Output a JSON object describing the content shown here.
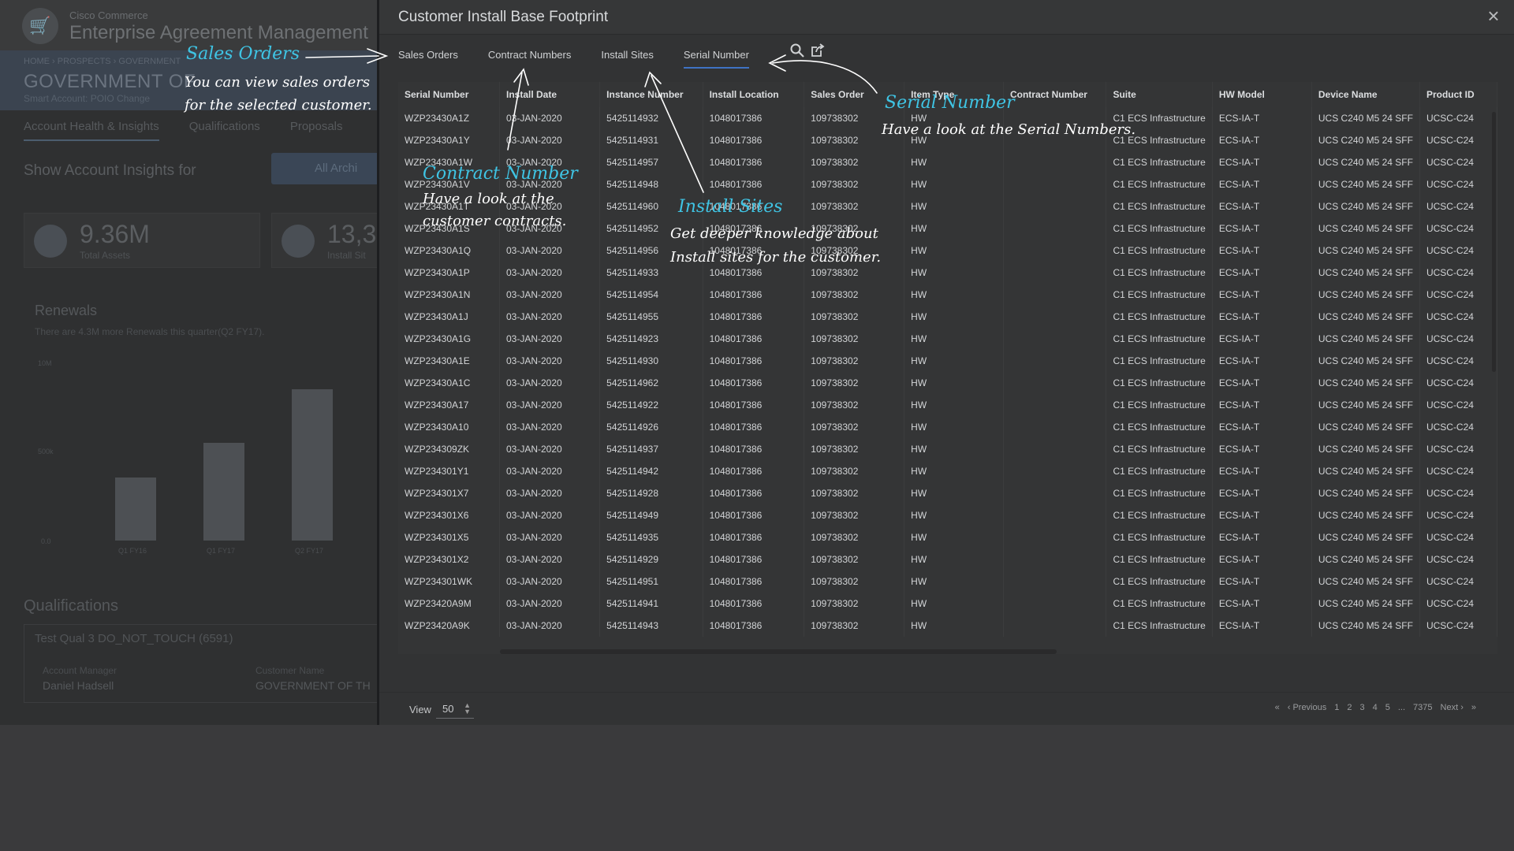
{
  "background": {
    "company": "Cisco Commerce",
    "app_name": "Enterprise Agreement Management",
    "breadcrumb": "HOME  ›  PROSPECTS  ›  GOVERNMENT",
    "customer_name": "GOVERNMENT OF",
    "smart_account": "Smart Account: POIO Change",
    "tabs": [
      "Account Health & Insights",
      "Qualifications",
      "Proposals"
    ],
    "insights_label": "Show Account Insights for",
    "archive_label": "All Archi",
    "cards": [
      {
        "value": "9.36M",
        "label": "Total Assets"
      },
      {
        "value": "13,3",
        "label": "Install Sit"
      }
    ],
    "renewals_title": "Renewals",
    "renewals_sub": "There are 4.3M more Renewals this quarter(Q2 FY17).",
    "chart_y_ticks": [
      "10M",
      "500k",
      "0.0"
    ],
    "chart_x_labels": [
      "Q1 FY16",
      "Q1 FY17",
      "Q2 FY17"
    ],
    "qualifications_title": "Qualifications",
    "qualification_name": "Test Qual 3 DO_NOT_TOUCH (6591)",
    "account_manager_label": "Account Manager",
    "account_manager": "Daniel Hadsell",
    "customer_name_label": "Customer Name",
    "customer_name_value": "GOVERNMENT OF TH"
  },
  "modal": {
    "title": "Customer Install Base Footprint",
    "close_glyph": "×",
    "tabs": [
      {
        "label": "Sales Orders",
        "active": false
      },
      {
        "label": "Contract Numbers",
        "active": false
      },
      {
        "label": "Install Sites",
        "active": false
      },
      {
        "label": "Serial Number",
        "active": true
      }
    ],
    "columns": [
      "Serial Number",
      "Install Date",
      "Instance Number",
      "Install Location",
      "Sales Order",
      "Item Type",
      "Contract Number",
      "Suite",
      "HW Model",
      "Device Name",
      "Product ID"
    ],
    "rows": [
      [
        "WZP23430A1Z",
        "03-JAN-2020",
        "5425114932",
        "1048017386",
        "109738302",
        "HW",
        "",
        "C1 ECS Infrastructure",
        "ECS-IA-T",
        "UCS C240 M5 24 SFF",
        "UCSC-C24"
      ],
      [
        "WZP23430A1Y",
        "03-JAN-2020",
        "5425114931",
        "1048017386",
        "109738302",
        "HW",
        "",
        "C1 ECS Infrastructure",
        "ECS-IA-T",
        "UCS C240 M5 24 SFF",
        "UCSC-C24"
      ],
      [
        "WZP23430A1W",
        "03-JAN-2020",
        "5425114957",
        "1048017386",
        "109738302",
        "HW",
        "",
        "C1 ECS Infrastructure",
        "ECS-IA-T",
        "UCS C240 M5 24 SFF",
        "UCSC-C24"
      ],
      [
        "WZP23430A1V",
        "03-JAN-2020",
        "5425114948",
        "1048017386",
        "109738302",
        "HW",
        "",
        "C1 ECS Infrastructure",
        "ECS-IA-T",
        "UCS C240 M5 24 SFF",
        "UCSC-C24"
      ],
      [
        "WZP23430A1T",
        "03-JAN-2020",
        "5425114960",
        "1048017386",
        "109738302",
        "HW",
        "",
        "C1 ECS Infrastructure",
        "ECS-IA-T",
        "UCS C240 M5 24 SFF",
        "UCSC-C24"
      ],
      [
        "WZP23430A1S",
        "03-JAN-2020",
        "5425114952",
        "1048017386",
        "109738302",
        "HW",
        "",
        "C1 ECS Infrastructure",
        "ECS-IA-T",
        "UCS C240 M5 24 SFF",
        "UCSC-C24"
      ],
      [
        "WZP23430A1Q",
        "03-JAN-2020",
        "5425114956",
        "1048017386",
        "109738302",
        "HW",
        "",
        "C1 ECS Infrastructure",
        "ECS-IA-T",
        "UCS C240 M5 24 SFF",
        "UCSC-C24"
      ],
      [
        "WZP23430A1P",
        "03-JAN-2020",
        "5425114933",
        "1048017386",
        "109738302",
        "HW",
        "",
        "C1 ECS Infrastructure",
        "ECS-IA-T",
        "UCS C240 M5 24 SFF",
        "UCSC-C24"
      ],
      [
        "WZP23430A1N",
        "03-JAN-2020",
        "5425114954",
        "1048017386",
        "109738302",
        "HW",
        "",
        "C1 ECS Infrastructure",
        "ECS-IA-T",
        "UCS C240 M5 24 SFF",
        "UCSC-C24"
      ],
      [
        "WZP23430A1J",
        "03-JAN-2020",
        "5425114955",
        "1048017386",
        "109738302",
        "HW",
        "",
        "C1 ECS Infrastructure",
        "ECS-IA-T",
        "UCS C240 M5 24 SFF",
        "UCSC-C24"
      ],
      [
        "WZP23430A1G",
        "03-JAN-2020",
        "5425114923",
        "1048017386",
        "109738302",
        "HW",
        "",
        "C1 ECS Infrastructure",
        "ECS-IA-T",
        "UCS C240 M5 24 SFF",
        "UCSC-C24"
      ],
      [
        "WZP23430A1E",
        "03-JAN-2020",
        "5425114930",
        "1048017386",
        "109738302",
        "HW",
        "",
        "C1 ECS Infrastructure",
        "ECS-IA-T",
        "UCS C240 M5 24 SFF",
        "UCSC-C24"
      ],
      [
        "WZP23430A1C",
        "03-JAN-2020",
        "5425114962",
        "1048017386",
        "109738302",
        "HW",
        "",
        "C1 ECS Infrastructure",
        "ECS-IA-T",
        "UCS C240 M5 24 SFF",
        "UCSC-C24"
      ],
      [
        "WZP23430A17",
        "03-JAN-2020",
        "5425114922",
        "1048017386",
        "109738302",
        "HW",
        "",
        "C1 ECS Infrastructure",
        "ECS-IA-T",
        "UCS C240 M5 24 SFF",
        "UCSC-C24"
      ],
      [
        "WZP23430A10",
        "03-JAN-2020",
        "5425114926",
        "1048017386",
        "109738302",
        "HW",
        "",
        "C1 ECS Infrastructure",
        "ECS-IA-T",
        "UCS C240 M5 24 SFF",
        "UCSC-C24"
      ],
      [
        "WZP234309ZK",
        "03-JAN-2020",
        "5425114937",
        "1048017386",
        "109738302",
        "HW",
        "",
        "C1 ECS Infrastructure",
        "ECS-IA-T",
        "UCS C240 M5 24 SFF",
        "UCSC-C24"
      ],
      [
        "WZP234301Y1",
        "03-JAN-2020",
        "5425114942",
        "1048017386",
        "109738302",
        "HW",
        "",
        "C1 ECS Infrastructure",
        "ECS-IA-T",
        "UCS C240 M5 24 SFF",
        "UCSC-C24"
      ],
      [
        "WZP234301X7",
        "03-JAN-2020",
        "5425114928",
        "1048017386",
        "109738302",
        "HW",
        "",
        "C1 ECS Infrastructure",
        "ECS-IA-T",
        "UCS C240 M5 24 SFF",
        "UCSC-C24"
      ],
      [
        "WZP234301X6",
        "03-JAN-2020",
        "5425114949",
        "1048017386",
        "109738302",
        "HW",
        "",
        "C1 ECS Infrastructure",
        "ECS-IA-T",
        "UCS C240 M5 24 SFF",
        "UCSC-C24"
      ],
      [
        "WZP234301X5",
        "03-JAN-2020",
        "5425114935",
        "1048017386",
        "109738302",
        "HW",
        "",
        "C1 ECS Infrastructure",
        "ECS-IA-T",
        "UCS C240 M5 24 SFF",
        "UCSC-C24"
      ],
      [
        "WZP234301X2",
        "03-JAN-2020",
        "5425114929",
        "1048017386",
        "109738302",
        "HW",
        "",
        "C1 ECS Infrastructure",
        "ECS-IA-T",
        "UCS C240 M5 24 SFF",
        "UCSC-C24"
      ],
      [
        "WZP234301WK",
        "03-JAN-2020",
        "5425114951",
        "1048017386",
        "109738302",
        "HW",
        "",
        "C1 ECS Infrastructure",
        "ECS-IA-T",
        "UCS C240 M5 24 SFF",
        "UCSC-C24"
      ],
      [
        "WZP23420A9M",
        "03-JAN-2020",
        "5425114941",
        "1048017386",
        "109738302",
        "HW",
        "",
        "C1 ECS Infrastructure",
        "ECS-IA-T",
        "UCS C240 M5 24 SFF",
        "UCSC-C24"
      ],
      [
        "WZP23420A9K",
        "03-JAN-2020",
        "5425114943",
        "1048017386",
        "109738302",
        "HW",
        "",
        "C1 ECS Infrastructure",
        "ECS-IA-T",
        "UCS C240 M5 24 SFF",
        "UCSC-C24"
      ]
    ],
    "footer": {
      "view_label": "View",
      "page_size": "50",
      "pager": {
        "first": "«",
        "previous": "‹ Previous",
        "pages": [
          "1",
          "2",
          "3",
          "4",
          "5"
        ],
        "ellipsis": "...",
        "last_page": "7375",
        "next": "Next ›",
        "last": "»"
      }
    },
    "icons": [
      "search-icon",
      "export-icon",
      "close-icon"
    ]
  },
  "hints": {
    "sales_orders": {
      "title": "Sales Orders",
      "lines": [
        "You can view sales orders",
        "for the selected customer."
      ]
    },
    "contract_number": {
      "title": "Contract Number",
      "lines": [
        "Have a look at the",
        "customer contracts."
      ]
    },
    "install_sites": {
      "title": "Install Sites",
      "lines": [
        "Get deeper knowledge about",
        "Install sites for the customer."
      ]
    },
    "serial_number": {
      "title": "Serial Number",
      "lines": [
        "Have a look at the Serial Numbers."
      ]
    }
  },
  "colors": {
    "hint_title": "#3fc4e4",
    "hint_body": "#ffffff",
    "active_tab_underline": "#3f73c4",
    "modal_bg": "#323334",
    "overlay": "#3a3a3c"
  }
}
